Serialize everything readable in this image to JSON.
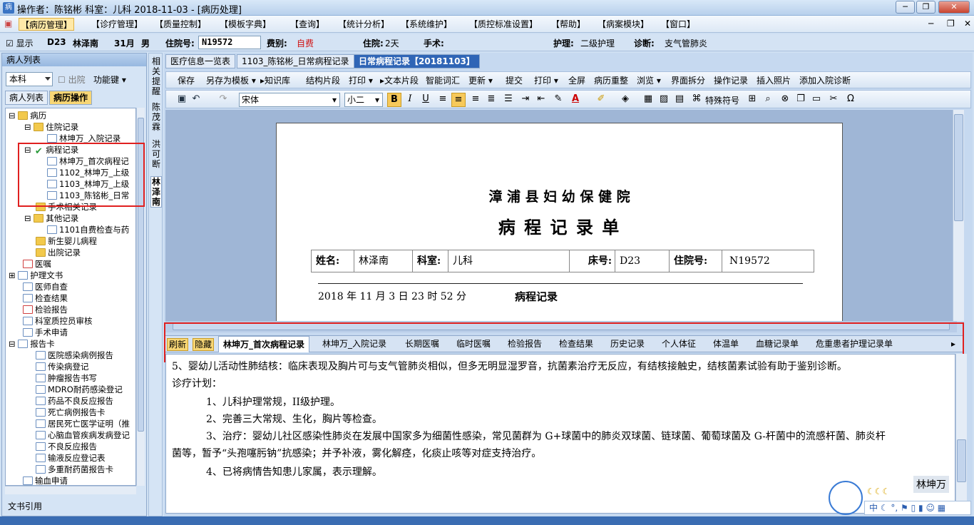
{
  "window": {
    "title": "操作者：陈铭彬  科室：儿科  2018-11-03 - [病历处理]"
  },
  "menu": [
    "【病历管理】",
    "【诊疗管理】",
    "【质量控制】",
    "【模板字典】",
    "【查询】",
    "【统计分析】",
    "【系统维护】",
    "【质控标准设置】",
    "【帮助】",
    "【病案模块】",
    "【窗口】"
  ],
  "info": {
    "show_label": "显示",
    "bed": "D23",
    "name": "林泽南",
    "age": "31月",
    "sex": "男",
    "admission_label": "住院号:",
    "admission_no": "N19572",
    "fee_label": "费别:",
    "fee": "自费",
    "stay_label": "住院:",
    "stay": "2天",
    "surgery_label": "手术:",
    "nursing_label": "护理:",
    "nursing": "二级护理",
    "diagnosis_label": "诊断:",
    "diagnosis": "支气管肺炎"
  },
  "left": {
    "header": "病人列表",
    "dept": "本科",
    "discharged": "出院",
    "function_key": "功能键",
    "tabs": [
      "病人列表",
      "病历操作"
    ],
    "footer": "文书引用",
    "tree": [
      "病历",
      "住院记录",
      "林坤万_入院记录",
      "病程记录",
      "林坤万_首次病程记",
      "1102_林坤万_上级",
      "1103_林坤万_上级",
      "1103_陈铭彬_日常",
      "手术相关记录",
      "其他记录",
      "1101自费检查与药",
      "新生婴儿病程",
      "出院记录",
      "医嘱",
      "护理文书",
      "医师自查",
      "检查结果",
      "检验报告",
      "科室质控员审核",
      "手术申请",
      "报告卡",
      "医院感染病例报告",
      "传染病登记",
      "肿瘤报告书写",
      "MDRO耐药感染登记",
      "药品不良反应报告",
      "死亡病例报告卡",
      "居民死亡医学证明（推",
      "心脑血管疾病发病登记",
      "不良反应报告",
      "输液反应登记表",
      "多重耐药菌报告卡",
      "输血申请"
    ]
  },
  "vstrip": {
    "reminder": "相关提醒",
    "doctor1": "陈茂霖",
    "doctor2": "洪可断",
    "patient": "林泽南"
  },
  "doctabs": [
    "医疗信息一览表",
    "1103_陈铭彬_日常病程记录",
    "日常病程记录【20181103】"
  ],
  "toolbar1": [
    "保存",
    "另存为模板",
    "知识库",
    "结构片段",
    "打印",
    "文本片段",
    "智能词汇",
    "更新",
    "提交",
    "打印",
    "全屏",
    "病历重整",
    "浏览",
    "界面拆分",
    "操作记录",
    "插入照片",
    "添加入院诊断"
  ],
  "format": {
    "font": "宋体",
    "size": "小二",
    "special": "特殊符号"
  },
  "document": {
    "hospital": "漳 浦 县 妇 幼 保 健 院",
    "form_title": "病 程 记 录 单",
    "name_label": "姓名:",
    "name": "林泽南",
    "dept_label": "科室:",
    "dept": "儿科",
    "bed_label": "床号:",
    "bed": "D23",
    "adm_label": "住院号:",
    "adm": "N19572",
    "datetime": "2018 年 11 月 3 日 23 时 52 分",
    "record_title": "病程记录"
  },
  "bottomtabs": [
    "刷新",
    "隐藏",
    "林坤万_首次病程记录",
    "林坤万_入院记录",
    "长期医嘱",
    "临时医嘱",
    "检验报告",
    "检查结果",
    "历史记录",
    "个人体征",
    "体温单",
    "血糖记录单",
    "危重患者护理记录单"
  ],
  "text": {
    "line1": "5、婴幼儿活动性肺结核：临床表现及胸片可与支气管肺炎相似，但多无明显湿罗音，抗菌素治疗无反应，有结核接触史，结核菌素试验有助于鉴别诊断。",
    "line2": "诊疗计划：",
    "line3": "1、儿科护理常规，II级护理。",
    "line4": "2、完善三大常规、生化，胸片等检查。",
    "line5": "3、治疗：婴幼儿社区感染性肺炎在发展中国家多为细菌性感染，常见菌群为 G+球菌中的肺炎双球菌、链球菌、葡萄球菌及 G-杆菌中的流感杆菌、肺炎杆",
    "line6": "菌等，暂予“头孢噻肟钠”抗感染；并予补液，雾化解痉，化痰止咳等对症支持治疗。",
    "line7": "4、已将病情告知患儿家属，表示理解。",
    "signature": "林坤万"
  },
  "ime": {
    "mode": "中"
  }
}
